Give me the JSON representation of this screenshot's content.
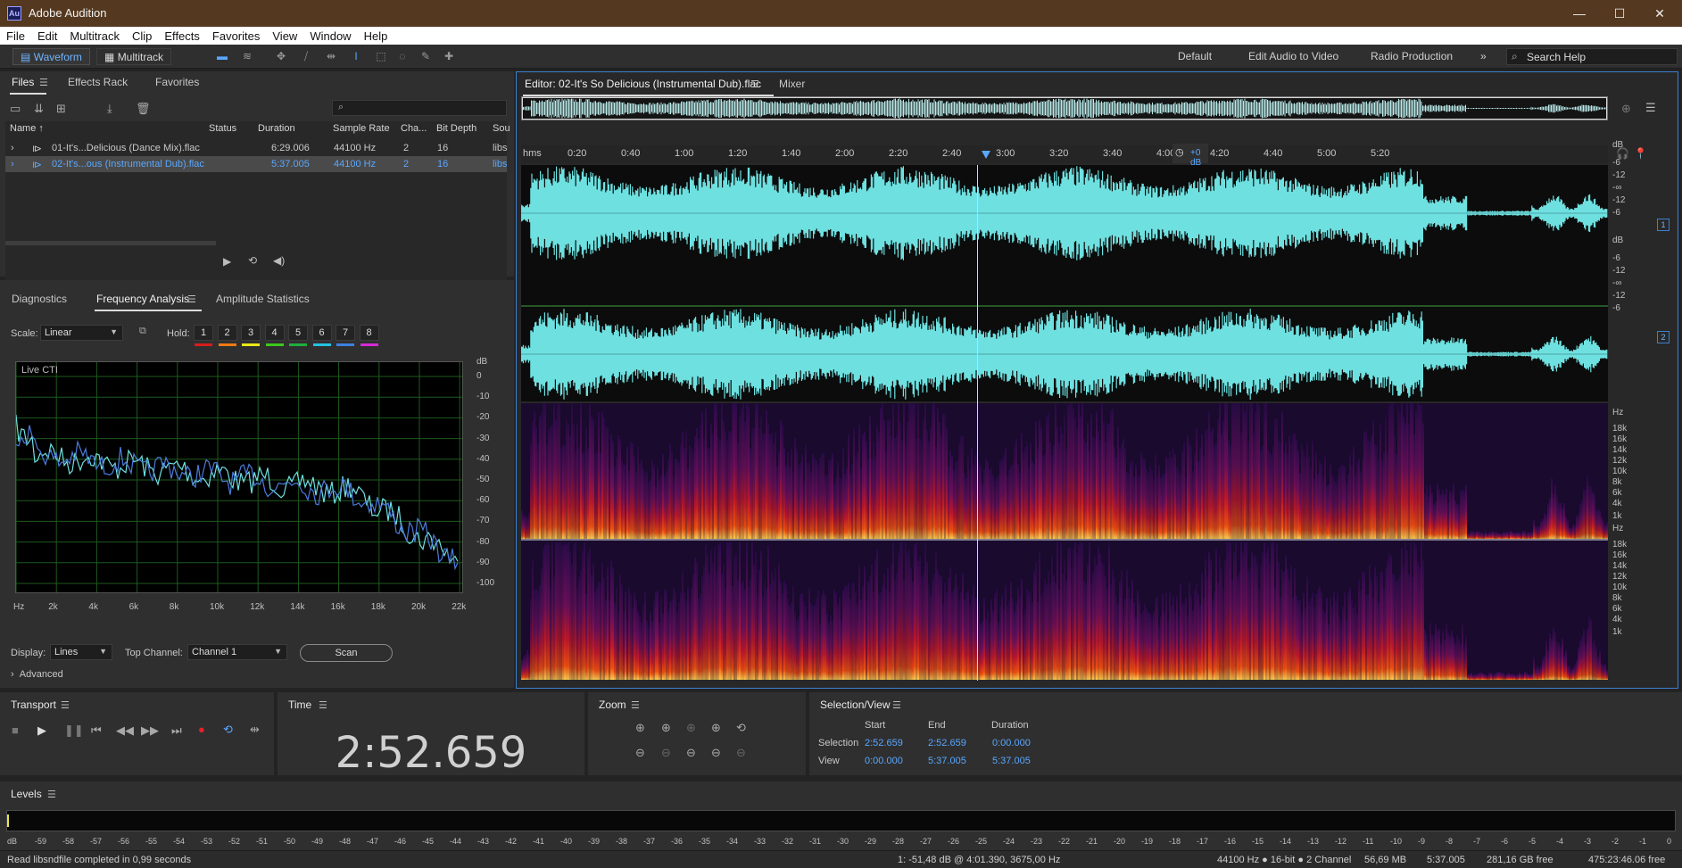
{
  "window": {
    "app_logo": "Au",
    "title": "Adobe Audition"
  },
  "menu": [
    "File",
    "Edit",
    "Multitrack",
    "Clip",
    "Effects",
    "Favorites",
    "View",
    "Window",
    "Help"
  ],
  "toolbar": {
    "waveform_label": "Waveform",
    "multitrack_label": "Multitrack",
    "workspaces": [
      "Default",
      "Edit Audio to Video",
      "Radio Production"
    ],
    "search_placeholder": "Search Help"
  },
  "files_panel": {
    "tabs": [
      "Files",
      "Effects Rack",
      "Favorites"
    ],
    "columns": [
      "Name",
      "Status",
      "Duration",
      "Sample Rate",
      "Cha...",
      "Bit Depth",
      "Sou"
    ],
    "rows": [
      {
        "name": "01-It's...Delicious (Dance Mix).flac",
        "status": "",
        "duration": "6:29.006",
        "rate": "44100 Hz",
        "ch": "2",
        "bits": "16",
        "source": "libs"
      },
      {
        "name": "02-It's...ous (Instrumental Dub).flac",
        "status": "",
        "duration": "5:37.005",
        "rate": "44100 Hz",
        "ch": "2",
        "bits": "16",
        "source": "libs",
        "selected": true
      }
    ]
  },
  "freq_panel": {
    "tabs": [
      "Diagnostics",
      "Frequency Analysis",
      "Amplitude Statistics"
    ],
    "scale_label": "Scale:",
    "scale_value": "Linear",
    "hold_label": "Hold:",
    "hold_buttons": [
      "1",
      "2",
      "3",
      "4",
      "5",
      "6",
      "7",
      "8"
    ],
    "hold_colors": [
      "#d71d1d",
      "#f07a12",
      "#e8e81a",
      "#3ec81e",
      "#1fae3b",
      "#22c3e0",
      "#3e7fe0",
      "#d52ad5"
    ],
    "graph_label": "Live CTI",
    "db_unit": "dB",
    "db_ticks": [
      "0",
      "-10",
      "-20",
      "-30",
      "-40",
      "-50",
      "-60",
      "-70",
      "-80",
      "-90",
      "-100"
    ],
    "hz_ticks": [
      "Hz",
      "2k",
      "4k",
      "6k",
      "8k",
      "10k",
      "12k",
      "14k",
      "16k",
      "18k",
      "20k",
      "22k"
    ],
    "display_label": "Display:",
    "display_value": "Lines",
    "top_channel_label": "Top Channel:",
    "top_channel_value": "Channel 1",
    "scan_label": "Scan",
    "advanced_label": "Advanced"
  },
  "editor": {
    "tab_title": "Editor: 02-It's So Delicious (Instrumental Dub).flac",
    "mixer_label": "Mixer",
    "ruler_unit": "hms",
    "ruler_ticks": [
      "0:20",
      "0:40",
      "1:00",
      "1:20",
      "1:40",
      "2:00",
      "2:20",
      "2:40",
      "3:00",
      "3:20",
      "3:40",
      "4:00",
      "4:20",
      "4:40",
      "5:00",
      "5:20"
    ],
    "gain_label": "+0 dB",
    "wave_scale": [
      "dB",
      "-6",
      "-12",
      "-∞",
      "-12",
      "-6"
    ],
    "channel_badges": [
      "1",
      "2"
    ],
    "spec_scale": [
      "Hz",
      "18k",
      "16k",
      "14k",
      "12k",
      "10k",
      "8k",
      "6k",
      "4k",
      "1k"
    ]
  },
  "transport": {
    "title": "Transport"
  },
  "time": {
    "title": "Time",
    "value": "2:52.659"
  },
  "zoom": {
    "title": "Zoom"
  },
  "selection_view": {
    "title": "Selection/View",
    "headers": [
      "Start",
      "End",
      "Duration"
    ],
    "selection_label": "Selection",
    "selection": [
      "2:52.659",
      "2:52.659",
      "0:00.000"
    ],
    "view_label": "View",
    "view": [
      "0:00.000",
      "5:37.005",
      "5:37.005"
    ]
  },
  "levels": {
    "title": "Levels",
    "scale": [
      "dB",
      "-59",
      "-58",
      "-57",
      "-56",
      "-55",
      "-54",
      "-53",
      "-52",
      "-51",
      "-50",
      "-49",
      "-48",
      "-47",
      "-46",
      "-45",
      "-44",
      "-43",
      "-42",
      "-41",
      "-40",
      "-39",
      "-38",
      "-37",
      "-36",
      "-35",
      "-34",
      "-33",
      "-32",
      "-31",
      "-30",
      "-29",
      "-28",
      "-27",
      "-26",
      "-25",
      "-24",
      "-23",
      "-22",
      "-21",
      "-20",
      "-19",
      "-18",
      "-17",
      "-16",
      "-15",
      "-14",
      "-13",
      "-12",
      "-11",
      "-10",
      "-9",
      "-8",
      "-7",
      "-6",
      "-5",
      "-4",
      "-3",
      "-2",
      "-1",
      "0"
    ]
  },
  "status": {
    "message": "Read libsndfile completed in 0,99 seconds",
    "cursor": "1: -51,48 dB @ 4:01.390, 3675,00 Hz",
    "format": "44100 Hz ● 16-bit ● 2 Channel",
    "size": "56,69 MB",
    "duration": "5:37.005",
    "free": "281,16 GB free",
    "free_time": "475:23:46.06 free"
  },
  "colors": {
    "accent": "#5aa7ff",
    "waveform": "#6fe0e0",
    "title_bar": "#54381f",
    "selection_outline": "#3d7fd1"
  }
}
